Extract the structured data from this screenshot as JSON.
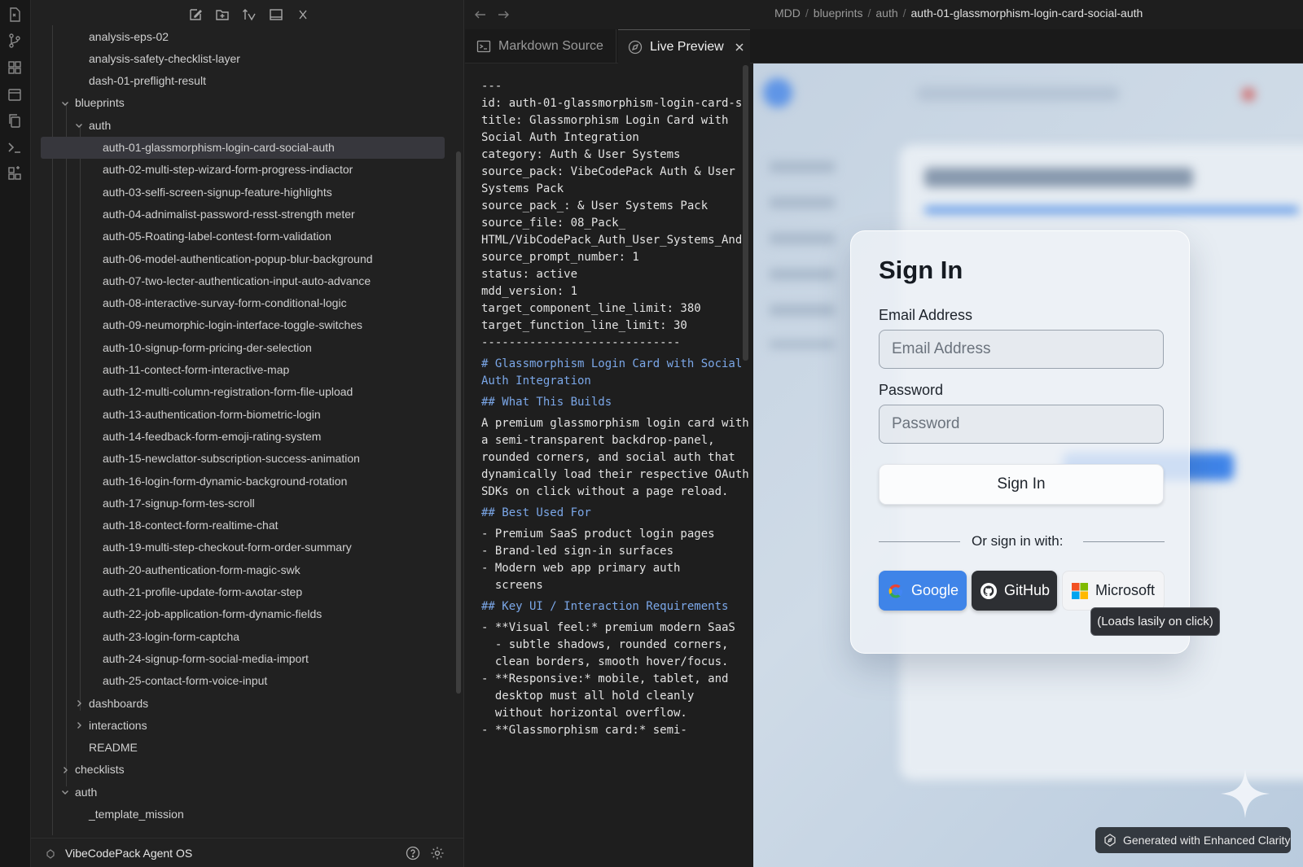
{
  "sidebar": {
    "tree": [
      {
        "label": "analysis-eps-02",
        "depth": 2,
        "type": "file"
      },
      {
        "label": "analysis-safety-checklist-layer",
        "depth": 2,
        "type": "file"
      },
      {
        "label": "dash-01-preflight-result",
        "depth": 2,
        "type": "file"
      },
      {
        "label": "blueprints",
        "depth": 1,
        "type": "folder",
        "expanded": true
      },
      {
        "label": "auth",
        "depth": 2,
        "type": "folder",
        "expanded": true
      },
      {
        "label": "auth-01-glassmorphism-login-card-social-auth",
        "depth": 3,
        "type": "file",
        "selected": true
      },
      {
        "label": "auth-02-multi-step-wizard-form-progress-indiactor",
        "depth": 3,
        "type": "file"
      },
      {
        "label": "auth-03-selfi-screen-signup-feature-highlights",
        "depth": 3,
        "type": "file"
      },
      {
        "label": "auth-04-adnimalist-password-resst-strength meter",
        "depth": 3,
        "type": "file"
      },
      {
        "label": "auth-05-Roating-label-contest-form-validation",
        "depth": 3,
        "type": "file"
      },
      {
        "label": "auth-06-model-authentication-popup-blur-background",
        "depth": 3,
        "type": "file"
      },
      {
        "label": "auth-07-two-lecter-authentication-input-auto-advance",
        "depth": 3,
        "type": "file"
      },
      {
        "label": "auth-08-interactive-survay-form-conditional-logic",
        "depth": 3,
        "type": "file"
      },
      {
        "label": "auth-09-neumorphic-login-interface-toggle-switches",
        "depth": 3,
        "type": "file"
      },
      {
        "label": "auth-10-signup-form-pricing-der-selection",
        "depth": 3,
        "type": "file"
      },
      {
        "label": "auth-11-contect-form-interactive-map",
        "depth": 3,
        "type": "file"
      },
      {
        "label": "auth-12-multi-column-registration-form-file-upload",
        "depth": 3,
        "type": "file"
      },
      {
        "label": "auth-13-authentication-form-biometric-login",
        "depth": 3,
        "type": "file"
      },
      {
        "label": "auth-14-feedback-form-emoji-rating-system",
        "depth": 3,
        "type": "file"
      },
      {
        "label": "auth-15-newclattor-subscription-success-animation",
        "depth": 3,
        "type": "file"
      },
      {
        "label": "auth-16-login-form-dynamic-background-rotation",
        "depth": 3,
        "type": "file"
      },
      {
        "label": "auth-17-signup-form-tes-scroll",
        "depth": 3,
        "type": "file"
      },
      {
        "label": "auth-18-contect-form-realtime-chat",
        "depth": 3,
        "type": "file"
      },
      {
        "label": "auth-19-multi-step-checkout-form-order-summary",
        "depth": 3,
        "type": "file"
      },
      {
        "label": "auth-20-authentication-form-magic-swk",
        "depth": 3,
        "type": "file"
      },
      {
        "label": "auth-21-profile-update-form-aʌotar-step",
        "depth": 3,
        "type": "file"
      },
      {
        "label": "auth-22-job-application-form-dynamic-fields",
        "depth": 3,
        "type": "file"
      },
      {
        "label": "auth-23-login-form-captcha",
        "depth": 3,
        "type": "file"
      },
      {
        "label": "auth-24-signup-form-social-media-import",
        "depth": 3,
        "type": "file"
      },
      {
        "label": "auth-25-contact-form-voice-input",
        "depth": 3,
        "type": "file"
      },
      {
        "label": "dashboards",
        "depth": 2,
        "type": "folder",
        "expanded": false
      },
      {
        "label": "interactions",
        "depth": 2,
        "type": "folder",
        "expanded": false
      },
      {
        "label": "README",
        "depth": 2,
        "type": "file"
      },
      {
        "label": "checklists",
        "depth": 1,
        "type": "folder",
        "expanded": false
      },
      {
        "label": "auth",
        "depth": 1,
        "type": "folder",
        "expanded": true
      },
      {
        "label": "_template_mission",
        "depth": 2,
        "type": "file"
      }
    ],
    "vault_name": "VibeCodePack Agent OS"
  },
  "breadcrumb": {
    "root": "MDD",
    "sep": "/",
    "folder1": "blueprints",
    "folder2": "auth",
    "current": "auth-01-glassmorphism-login-card-social-auth"
  },
  "tabs": {
    "source": "Markdown Source",
    "preview": "Live Preview"
  },
  "editor": {
    "lines": [
      {
        "t": "---",
        "h": false
      },
      {
        "t": "id: auth-01-glassmorphism-login-card-s",
        "h": false
      },
      {
        "t": "title: Glassmorphism Login Card with",
        "h": false
      },
      {
        "t": "Social Auth Integration",
        "h": false
      },
      {
        "t": "category: Auth & User Systems",
        "h": false
      },
      {
        "t": "source_pack: VibeCodePack Auth & User",
        "h": false
      },
      {
        "t": "Systems Pack",
        "h": false
      },
      {
        "t": "source_pack_: & User Systems Pack",
        "h": false
      },
      {
        "t": "source_file: 08_Pack_",
        "h": false
      },
      {
        "t": "HTML/VibCodePack_Auth_User_Systems_And",
        "h": false
      },
      {
        "t": "source_prompt_number: 1",
        "h": false
      },
      {
        "t": "status: active",
        "h": false
      },
      {
        "t": "mdd_version: 1",
        "h": false
      },
      {
        "t": "target_component_line_limit: 380",
        "h": false
      },
      {
        "t": "target_function_line_limit: 30",
        "h": false
      },
      {
        "t": "-----------------------------",
        "h": false
      },
      {
        "t": "# Glassmorphism Login Card with Social",
        "h": true
      },
      {
        "t": "Auth Integration",
        "h": true
      },
      {
        "t": "## What This Builds",
        "h": true
      },
      {
        "t": "A premium glassmorphism login card with",
        "h": false
      },
      {
        "t": "a semi-transparent backdrop-panel,",
        "h": false
      },
      {
        "t": "rounded corners, and social auth that",
        "h": false
      },
      {
        "t": "dynamically load their respective OAuth",
        "h": false
      },
      {
        "t": "SDKs on click without a page reload.",
        "h": false
      },
      {
        "t": "## Best Used For",
        "h": true
      },
      {
        "t": "- Premium SaaS product login pages",
        "h": false
      },
      {
        "t": "- Brand-led sign-in surfaces",
        "h": false
      },
      {
        "t": "- Modern web app primary auth",
        "h": false
      },
      {
        "t": "  screens",
        "h": false
      },
      {
        "t": "## Key UI / Interaction Requirements",
        "h": true
      },
      {
        "t": "- **Visual feel:* premium modern SaaS",
        "h": false
      },
      {
        "t": "  - subtle shadows, rounded corners,",
        "h": false
      },
      {
        "t": "  clean borders, smooth hover/focus.",
        "h": false
      },
      {
        "t": "- **Responsive:* mobile, tablet, and",
        "h": false
      },
      {
        "t": "  desktop must all hold cleanly",
        "h": false
      },
      {
        "t": "  without horizontal overflow.",
        "h": false
      },
      {
        "t": "- **Glassmorphism card:* semi-",
        "h": false
      }
    ]
  },
  "login": {
    "title": "Sign In",
    "email_label": "Email Address",
    "email_placeholder": "Email Address",
    "password_label": "Password",
    "password_placeholder": "Password",
    "signin_button": "Sign In",
    "divider_text": "Or sign in with:",
    "google": "Google",
    "github": "GitHub",
    "microsoft": "Microsoft",
    "tooltip": "(Loads lasily on click)"
  },
  "badge": "Generated with Enhanced Clarity",
  "colors": {
    "accent_blue": "#3f84e8",
    "heading": "#7ba7e8",
    "selected_row": "#37373d"
  }
}
